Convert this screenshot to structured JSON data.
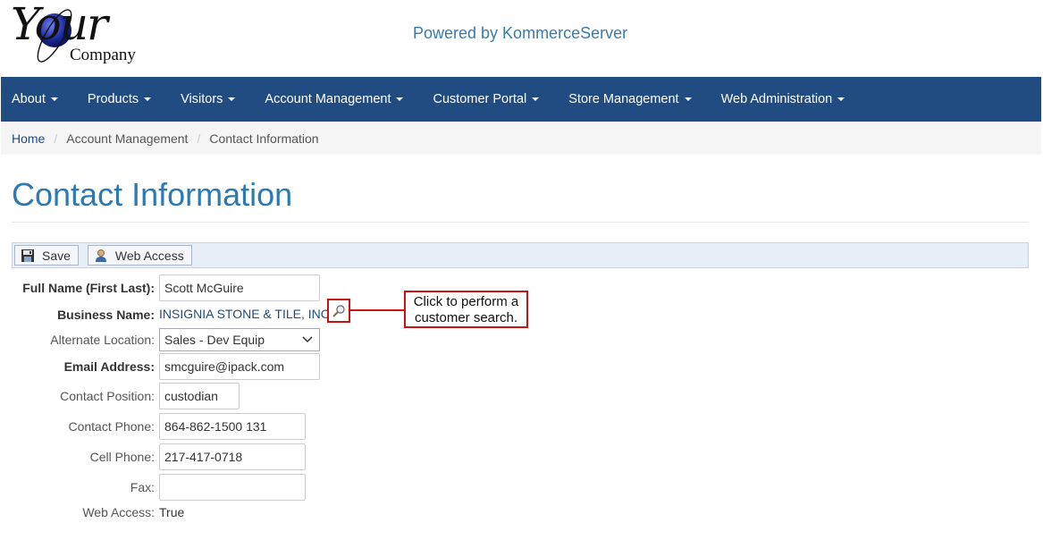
{
  "header": {
    "logo_main": "Your",
    "logo_sub": "Company",
    "powered_by": "Powered by KommerceServer"
  },
  "nav": {
    "items": [
      {
        "label": "About"
      },
      {
        "label": "Products"
      },
      {
        "label": "Visitors"
      },
      {
        "label": "Account Management"
      },
      {
        "label": "Customer Portal"
      },
      {
        "label": "Store Management"
      },
      {
        "label": "Web Administration"
      }
    ]
  },
  "breadcrumb": {
    "home": "Home",
    "account": "Account Management",
    "current": "Contact Information"
  },
  "page": {
    "title": "Contact Information"
  },
  "toolbar": {
    "save_label": "Save",
    "web_access_label": "Web Access"
  },
  "form": {
    "full_name_label": "Full Name (First Last):",
    "full_name_value": "Scott McGuire",
    "business_name_label": "Business Name:",
    "business_name_value": "INSIGNIA STONE & TILE, INC.",
    "alt_location_label": "Alternate Location:",
    "alt_location_value": "Sales - Dev Equip",
    "email_label": "Email Address:",
    "email_value": "smcguire@ipack.com",
    "position_label": "Contact Position:",
    "position_value": "custodian",
    "phone_label": "Contact Phone:",
    "phone_value": "864-862-1500 131",
    "cell_label": "Cell Phone:",
    "cell_value": "217-417-0718",
    "fax_label": "Fax:",
    "fax_value": "",
    "web_access_label": "Web Access:",
    "web_access_value": "True"
  },
  "callout": {
    "line1": "Click to perform a",
    "line2": "customer search."
  },
  "colors": {
    "navbar": "#214c82",
    "title": "#2b7ab4",
    "callout": "#cc1111"
  },
  "icons": {
    "save": "floppy-disk-icon",
    "web_access": "user-icon",
    "search": "magnifier-icon"
  }
}
